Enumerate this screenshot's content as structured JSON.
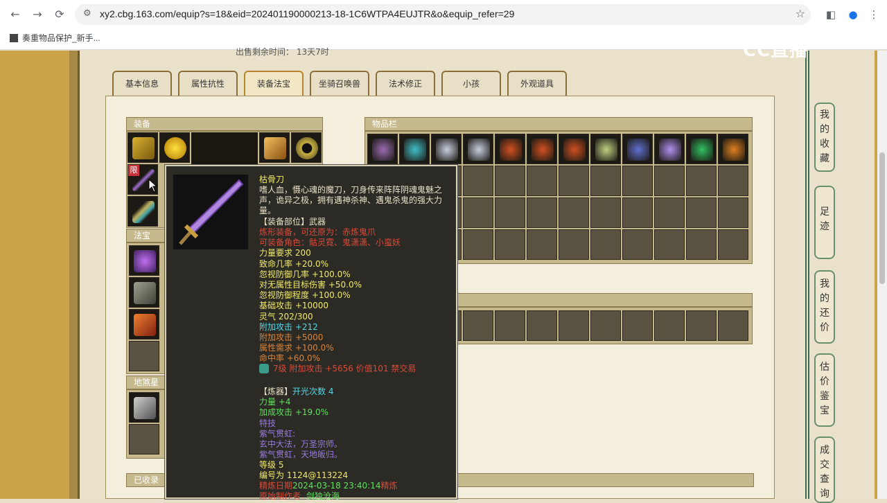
{
  "browser": {
    "url": "xy2.cbg.163.com/equip?s=18&eid=202401190000213-18-1C6WTPA4EUJTR&o&equip_refer=29",
    "bookmark": "奏重物品保护_新手..."
  },
  "page": {
    "time_text": "出售剩余时间：  13天7时",
    "logo": "CC直播",
    "tabs": [
      "基本信息",
      "属性抗性",
      "装备法宝",
      "坐骑召唤兽",
      "法术修正",
      "小孩",
      "外观道具"
    ],
    "active_tab": "装备法宝",
    "panels": {
      "equip": "装备",
      "inventory": "物品栏",
      "fabao": "法宝",
      "disha": "地煞星",
      "collected": "已收录"
    },
    "limit_badge": "限",
    "sidebar": [
      "我的收藏",
      "足迹",
      "我的还价",
      "估价鉴宝",
      "成交查询"
    ]
  },
  "tooltip": {
    "name": "枯骨刀",
    "desc_lines": [
      "嗜人血，慑心魂的魔刀，刀身传来阵阵阴魂鬼魅之",
      "声，诡异之极，拥有遇神杀神、遇鬼杀鬼的强大力",
      "量。"
    ],
    "slot_label": "【装备部位】武器",
    "lines": [
      {
        "text": "炼形装备，可还原为：赤炼鬼爪",
        "color": "#d84a3a"
      },
      {
        "text": "可装备角色：骷灵霓、鬼潇潇、小蛮妖",
        "color": "#d84a3a"
      },
      {
        "text": "力量要求 200",
        "color": "#f0ea6a"
      },
      {
        "text": "致命几率 +20.0%",
        "color": "#f0ea6a"
      },
      {
        "text": "忽视防御几率 +100.0%",
        "color": "#f0ea6a"
      },
      {
        "text": "对无属性目标伤害 +50.0%",
        "color": "#f0ea6a"
      },
      {
        "text": "忽视防御程度 +100.0%",
        "color": "#f0ea6a"
      },
      {
        "text": "基础攻击 +10000",
        "color": "#f0ea6a"
      },
      {
        "text": "灵气 202/300",
        "color": "#f0ea6a"
      },
      {
        "text": "附加攻击 +212",
        "color": "#4fd8e8"
      },
      {
        "text": "附加攻击 +5000",
        "color": "#d8843a"
      },
      {
        "text": "属性需求 +100.0%",
        "color": "#d8843a"
      },
      {
        "text": "命中率 +60.0%",
        "color": "#d8843a"
      }
    ],
    "gem_line": "7级 附加攻击 +5656 价值101 禁交易",
    "refine_label": "【炼器】",
    "refine_count": "开光次数 4",
    "refine_lines": [
      {
        "text": "力量 +4",
        "color": "#5fe05f"
      },
      {
        "text": "加成攻击 +19.0%",
        "color": "#5fe05f"
      }
    ],
    "skill_lines": [
      {
        "text": "特技",
        "color": "#9a7ae0"
      },
      {
        "text": "紫气贯虹:",
        "color": "#9a7ae0"
      },
      {
        "text": "玄中大法，万圣宗师。",
        "color": "#9a7ae0"
      },
      {
        "text": "紫气贯虹，天地皈归。",
        "color": "#9a7ae0"
      }
    ],
    "level": "等级 5",
    "serial": "编号为 1124@113224",
    "date_label": "精炼日期",
    "date": "2024-03-18 23:40:14",
    "date_suffix": "精炼",
    "last_label": "原始制作者",
    "last_value": "剑独沧海"
  },
  "colors": {
    "frame": "#c9a44a",
    "panel": "#f4efdc",
    "tooltip_bg": "#2c2a24"
  }
}
